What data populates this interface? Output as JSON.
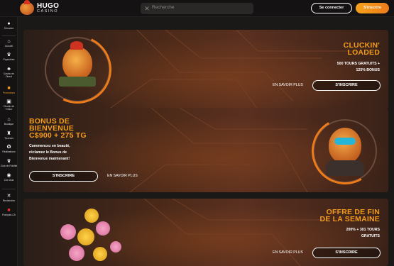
{
  "header": {
    "logo_name": "HUGO",
    "logo_sub": "CASINO",
    "search_placeholder": "Recherche",
    "login_label": "Se connecter",
    "signup_label": "S'inscrire"
  },
  "sidebar": {
    "items": [
      {
        "label": "S'inscrire",
        "icon": "user-icon"
      },
      {
        "label": "Accueil",
        "icon": "home-icon"
      },
      {
        "label": "Populaires",
        "icon": "crown-icon"
      },
      {
        "label": "Casino en Direct",
        "icon": "live-casino-icon"
      },
      {
        "label": "Promotions",
        "icon": "gift-icon"
      },
      {
        "label": "Choisir de Trésor",
        "icon": "treasure-icon"
      },
      {
        "label": "Boutique",
        "icon": "shop-icon"
      },
      {
        "label": "Tournois",
        "icon": "trophy-icon"
      },
      {
        "label": "Réalisations",
        "icon": "medal-icon"
      },
      {
        "label": "Club de Fidélité",
        "icon": "crown-icon"
      },
      {
        "label": "Live chat",
        "icon": "chat-icon"
      },
      {
        "label": "Rechercher",
        "icon": "search-icon"
      },
      {
        "label": "Français-CA",
        "icon": "flag-icon"
      }
    ]
  },
  "banners": [
    {
      "title_lines": [
        "CLUCKIN'",
        "LOADED"
      ],
      "desc_lines": [
        "500 TOURS GRATUITS +",
        "125% BONUS"
      ],
      "more_label": "EN SAVOIR PLUS",
      "cta_label": "S'INSCRIRE"
    },
    {
      "title_lines": [
        "BONUS DE",
        "BIENVENUE",
        "C$900 + 275 TG"
      ],
      "desc_lines": [
        "Commencez en beauté,",
        "réclamez le Bonus de",
        "Bienvenue maintenant!"
      ],
      "more_label": "EN SAVOIR PLUS",
      "cta_label": "S'INSCRIRE"
    },
    {
      "title_lines": [
        "OFFRE DE FIN",
        "DE LA SEMAINE"
      ],
      "desc_lines": [
        "200% + 301 TOURS",
        "GRATUITS"
      ],
      "more_label": "EN SAVOIR PLUS",
      "cta_label": "S'INSCRIRE"
    }
  ],
  "colors": {
    "accent": "#f39c1c",
    "background": "#0e0d0d"
  }
}
